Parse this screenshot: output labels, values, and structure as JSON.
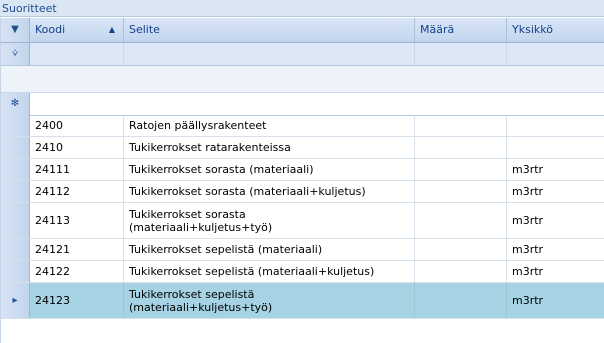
{
  "window": {
    "title": "Suoritteet"
  },
  "columns": [
    {
      "key": "koodi",
      "label": "Koodi",
      "sort": "▲"
    },
    {
      "key": "selite",
      "label": "Selite"
    },
    {
      "key": "maara",
      "label": "Määrä"
    },
    {
      "key": "yksikko",
      "label": "Yksikkö"
    }
  ],
  "icons": {
    "menu": "▼",
    "filter": "⩒",
    "new_row": "✻",
    "current_row": "▸"
  },
  "rows": [
    {
      "koodi": "2400",
      "selite": "Ratojen päällysrakenteet",
      "maara": "",
      "yksikko": ""
    },
    {
      "koodi": "2410",
      "selite": "Tukikerrokset ratarakenteissa",
      "maara": "",
      "yksikko": ""
    },
    {
      "koodi": "24111",
      "selite": "Tukikerrokset sorasta (materiaali)",
      "maara": "",
      "yksikko": "m3rtr"
    },
    {
      "koodi": "24112",
      "selite": "Tukikerrokset sorasta (materiaali+kuljetus)",
      "maara": "",
      "yksikko": "m3rtr"
    },
    {
      "koodi": "24113",
      "selite": "Tukikerrokset sorasta\n(materiaali+kuljetus+työ)",
      "maara": "",
      "yksikko": "m3rtr"
    },
    {
      "koodi": "24121",
      "selite": "Tukikerrokset sepelistä (materiaali)",
      "maara": "",
      "yksikko": "m3rtr"
    },
    {
      "koodi": "24122",
      "selite": "Tukikerrokset sepelistä (materiaali+kuljetus)",
      "maara": "",
      "yksikko": "m3rtr"
    },
    {
      "koodi": "24123",
      "selite": "Tukikerrokset sepelistä\n(materiaali+kuljetus+työ)",
      "maara": "",
      "yksikko": "m3rtr",
      "selected": true
    }
  ],
  "colors": {
    "selected_row": "#a5d3e4",
    "header_text": "#15428b"
  }
}
